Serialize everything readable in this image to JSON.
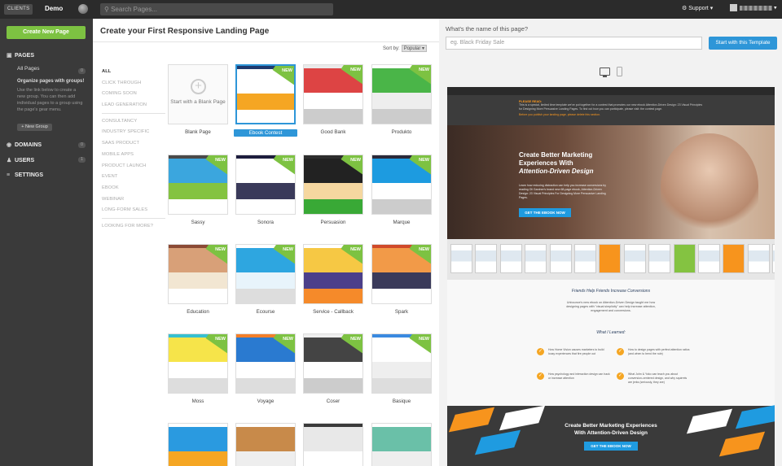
{
  "topbar": {
    "clients": "CLIENTS",
    "account": "Demo",
    "search_placeholder": "Search Pages...",
    "support": "Support"
  },
  "sidebar": {
    "create_button": "Create New Page",
    "pages_label": "PAGES",
    "pages_count": "0",
    "all_pages": "All Pages",
    "organize_title": "Organize pages with groups!",
    "organize_text": "Use the link below to create a new group. You can then add individual pages to a group using the page's gear menu.",
    "new_group": "+ New Group",
    "domains_label": "DOMAINS",
    "domains_count": "0",
    "users_label": "USERS",
    "users_count": "1",
    "settings_label": "SETTINGS"
  },
  "main": {
    "title": "Create your First Responsive Landing Page",
    "sort_label": "Sort by:",
    "sort_value": "Popular",
    "categories": [
      "ALL",
      "CLICK THROUGH",
      "COMING SOON",
      "LEAD GENERATION",
      "CONSULTANCY",
      "INDUSTRY SPECIFIC",
      "SAAS PRODUCT",
      "MOBILE APPS",
      "PRODUCT LAUNCH",
      "EVENT",
      "EBOOK",
      "WEBINAR",
      "LONG-FORM SALES",
      "LOOKING FOR MORE?"
    ],
    "blank_label": "Start with a Blank Page",
    "new_badge": "NEW",
    "templates": [
      {
        "name": "Blank Page"
      },
      {
        "name": "Ebook Contest"
      },
      {
        "name": "Good Bank"
      },
      {
        "name": "Produkto"
      },
      {
        "name": "Sassy"
      },
      {
        "name": "Sonora"
      },
      {
        "name": "Persuasion"
      },
      {
        "name": "Marque"
      },
      {
        "name": "Education"
      },
      {
        "name": "Ecourse"
      },
      {
        "name": "Service - Callback"
      },
      {
        "name": "Spark"
      },
      {
        "name": "Moss"
      },
      {
        "name": "Voyage"
      },
      {
        "name": "Coser"
      },
      {
        "name": "Basique"
      },
      {
        "name": ""
      },
      {
        "name": ""
      },
      {
        "name": ""
      },
      {
        "name": ""
      }
    ]
  },
  "right": {
    "question": "What's the name of this page?",
    "input_placeholder": "eg. Black Friday Sale",
    "start_button": "Start with this Template",
    "preview": {
      "notice_title": "PLEASE READ:",
      "notice_text": "This is a special, limited time template we've put together for a contest that promotes our new ebook Attention-Driven Design: 23 Visual Principles for Designing More Persuasive Landing Pages. To find out how you can participate, please visit: the contest page.",
      "notice_warn": "Before you publish your landing page, please delete this section.",
      "hero_line1": "Create Better Marketing",
      "hero_line2": "Experiences With",
      "hero_line3": "Attention-Driven Design",
      "hero_text": "Learn how reducing distraction can help you increase conversions by reading Oli Gardner's brand new 68-page ebook, Attention-Driven Design: 23 Visual Principles For Designing More Persuasive Landing Pages.",
      "hero_button": "GET THE EBOOK NOW",
      "section_title": "Friends Help Friends Increase Conversions",
      "section_text": "Unbounce's new ebook on Attention-Driven Design taught me how designing pages with \"visual simplicity\" can help increase attention, engagement and conversions.",
      "learned_title": "What I Learned:",
      "learned": [
        "How Home Vision causes marketers to build lousy experiences that fire people out",
        "How to design pages with perfect attention ratios (and when to bend the rule)",
        "How psychology and interaction design can hack or increase attention",
        "What John & Yoko can teach you about conversion-centered design, and why squirrels are jerks (seriously, they are)"
      ],
      "footer_line1": "Create Better Marketing Experiences",
      "footer_line2": "With Attention-Driven Design",
      "footer_button": "GET THE EBOOK NOW"
    }
  }
}
